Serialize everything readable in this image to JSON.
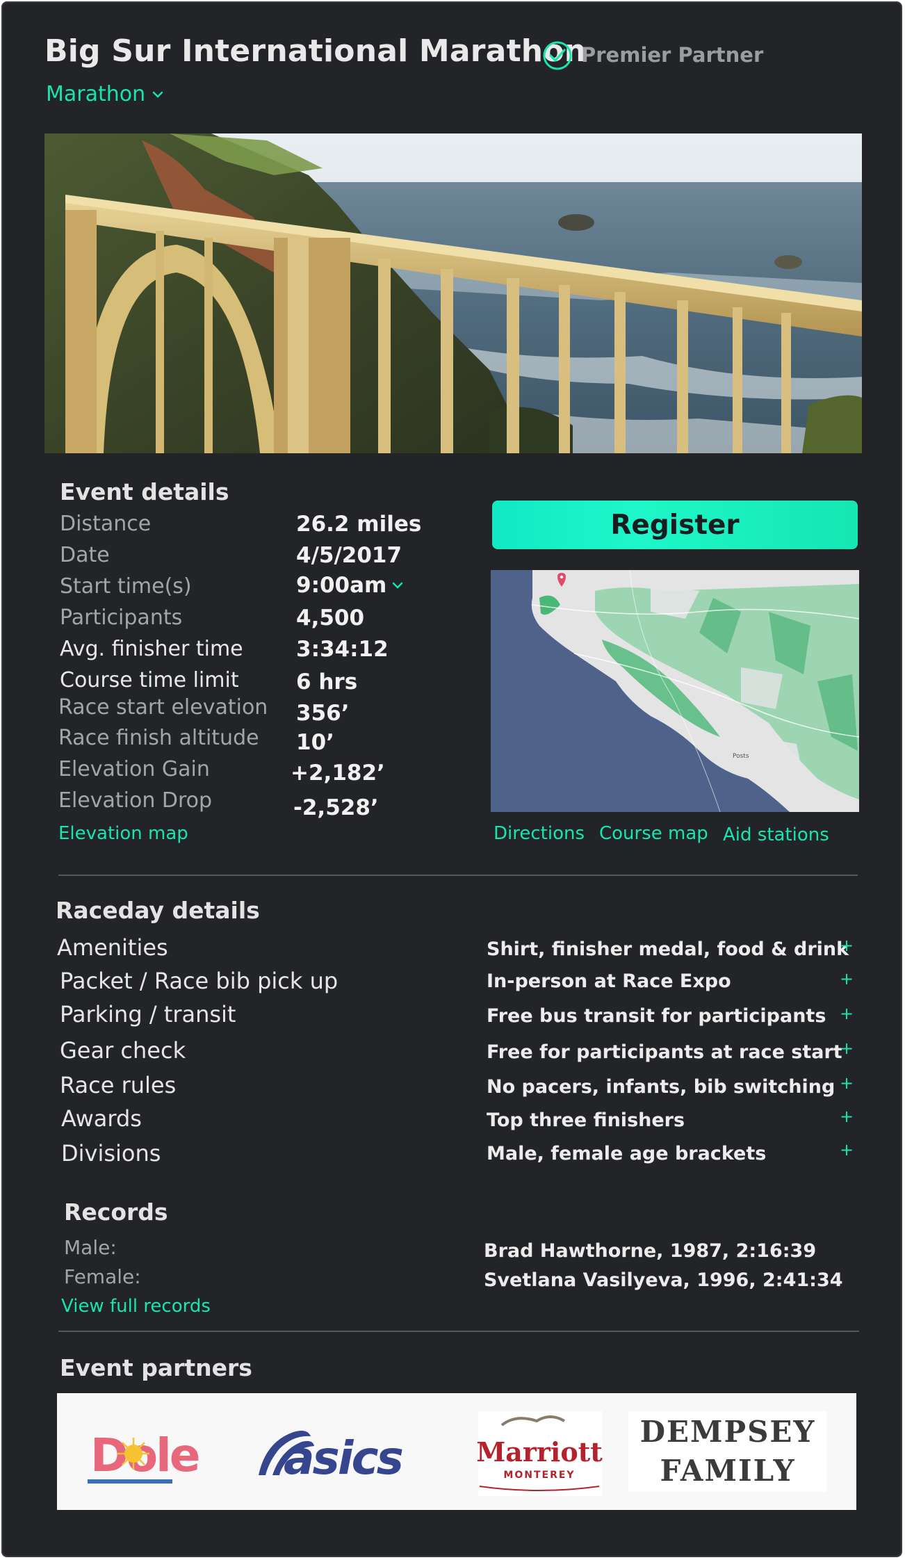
{
  "header": {
    "title": "Big Sur International Marathon",
    "badge": "Premier Partner",
    "race_type": "Marathon"
  },
  "colors": {
    "background": "#222427",
    "accent": "#18e5ad",
    "register_button": "#15efc4",
    "label_muted": "#a3a5a8"
  },
  "hero_image": {
    "description_icon": "bixby-bridge-photo"
  },
  "event_details": {
    "heading": "Event details",
    "rows": [
      {
        "label": "Distance",
        "value": "26.2 miles"
      },
      {
        "label": "Date",
        "value": "4/5/2017"
      },
      {
        "label": "Start time(s)",
        "value": "9:00am"
      },
      {
        "label": "Participants",
        "value": "4,500"
      },
      {
        "label": "Avg. finisher time",
        "value": "3:34:12"
      },
      {
        "label": "Course time limit",
        "value": "6 hrs"
      },
      {
        "label": "Race start elevation",
        "value": "356’"
      },
      {
        "label": "Race finish altitude",
        "value": "10’"
      },
      {
        "label": "Elevation Gain",
        "value": "+2,182’"
      },
      {
        "label": "Elevation Drop",
        "value": "-2,528’"
      }
    ],
    "elevation_map_link": "Elevation map"
  },
  "register": {
    "label": "Register"
  },
  "map": {
    "place_label": "Posts",
    "links": [
      "Directions",
      "Course map",
      "Aid stations"
    ]
  },
  "raceday": {
    "heading": "Raceday details",
    "rows": [
      {
        "label": "Amenities",
        "value": "Shirt, finisher medal, food & drink",
        "expand": "+"
      },
      {
        "label": "Packet / Race bib pick up",
        "value": "In-person at Race Expo",
        "expand": "+"
      },
      {
        "label": "Parking / transit",
        "value": "Free bus transit for participants",
        "expand": "+"
      },
      {
        "label": "Gear check",
        "value": "Free for participants at race start",
        "expand": "+"
      },
      {
        "label": "Race rules",
        "value": "No pacers, infants, bib switching",
        "expand": "+"
      },
      {
        "label": "Awards",
        "value": "Top three finishers",
        "expand": "+"
      },
      {
        "label": "Divisions",
        "value": "Male, female age brackets",
        "expand": "+"
      }
    ]
  },
  "records": {
    "heading": "Records",
    "rows": [
      {
        "label": "Male:",
        "value": "Brad Hawthorne, 1987, 2:16:39"
      },
      {
        "label": "Female:",
        "value": "Svetlana Vasilyeva, 1996, 2:41:34"
      }
    ],
    "link": "View full records"
  },
  "partners": {
    "heading": "Event partners",
    "logos": [
      {
        "name": "dole-logo",
        "text": "Dole"
      },
      {
        "name": "asics-logo",
        "text": "asics"
      },
      {
        "name": "marriott-logo",
        "text": "Marriott",
        "subtext": "MONTEREY"
      },
      {
        "name": "dempsey-family-logo",
        "line1": "DEMPSEY",
        "line2": "FAMILY"
      }
    ]
  }
}
